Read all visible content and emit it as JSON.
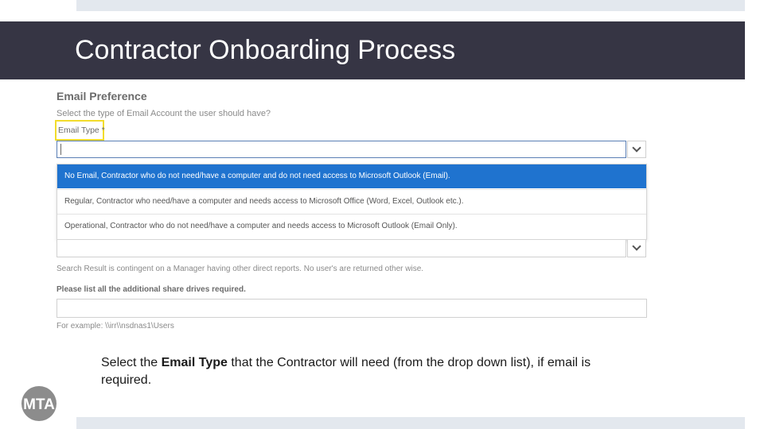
{
  "slide": {
    "title": "Contractor Onboarding Process"
  },
  "form": {
    "section_title": "Email Preference",
    "question": "Select the type of Email Account the user should have?",
    "email_type_label": "Email Type *",
    "email_type_value": "",
    "options": [
      {
        "label": "No Email, Contractor who do not need/have a computer and do not need access to Microsoft Outlook (Email).",
        "selected": true
      },
      {
        "label": "Regular, Contractor who need/have a computer and needs access to Microsoft Office (Word, Excel, Outlook etc.).",
        "selected": false
      },
      {
        "label": "Operational, Contractor who do not need/have a computer and needs access to Microsoft Outlook (Email Only).",
        "selected": false
      }
    ],
    "search_note": "Search Result is contingent on a Manager having other direct reports. No user's are returned other wise.",
    "share_drives_label": "Please list all the additional share drives required.",
    "example_text": "For example: \\\\irr\\\\nsdnas1\\Users"
  },
  "instruction": {
    "prefix": "Select the ",
    "bold": "Email Type",
    "suffix": " that the Contractor will need (from the drop down list), if email is required."
  },
  "logo": {
    "text": "MTA"
  },
  "colors": {
    "title_bar": "#363544",
    "highlight_border": "#f2dc2c",
    "selected_option": "#1f73cf",
    "strip": "#e3e8ee"
  }
}
